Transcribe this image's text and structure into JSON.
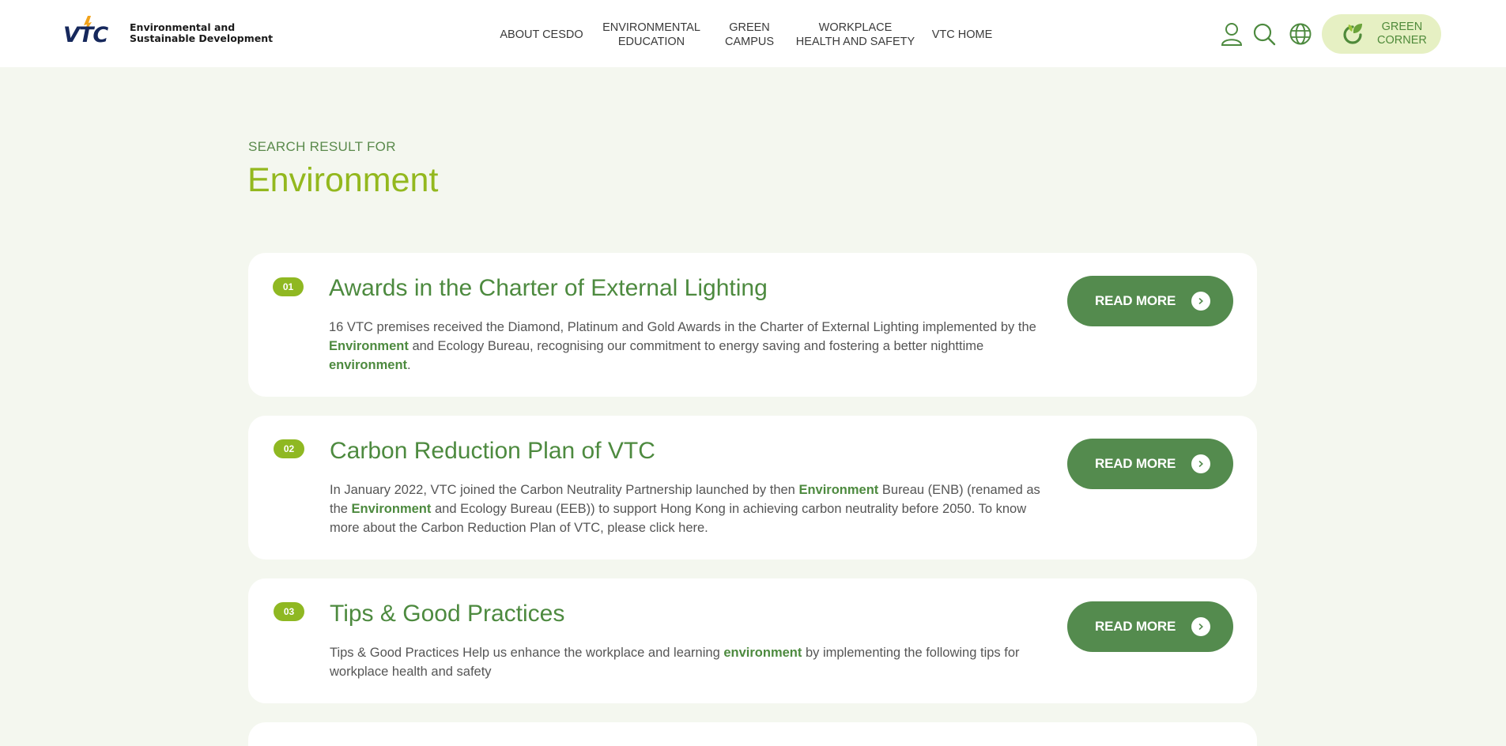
{
  "header": {
    "logo": {
      "mark": "VTC",
      "line1": "Environmental and",
      "line2": "Sustainable Development"
    },
    "nav": [
      {
        "label": "ABOUT CESDO"
      },
      {
        "label": "ENVIRONMENTAL\nEDUCATION"
      },
      {
        "label": "GREEN\nCAMPUS"
      },
      {
        "label": "WORKPLACE\nHEALTH AND SAFETY"
      },
      {
        "label": "VTC HOME"
      }
    ],
    "icons": [
      "user-icon",
      "search-icon",
      "globe-icon"
    ],
    "green_corner": {
      "label": "GREEN\nCORNER",
      "icon": "leaf-cycle-icon"
    }
  },
  "search": {
    "label": "SEARCH RESULT FOR",
    "term": "Environment"
  },
  "results": [
    {
      "number": "01",
      "title": "Awards in the Charter of External Lighting",
      "description_parts": [
        {
          "text": "16 VTC premises received the Diamond, Platinum and Gold Awards in the Charter of External Lighting implemented by the ",
          "hl": false
        },
        {
          "text": "Environment",
          "hl": true
        },
        {
          "text": " and Ecology Bureau, recognising our commitment to energy saving and fostering a better nighttime ",
          "hl": false
        },
        {
          "text": "environment",
          "hl": true
        },
        {
          "text": ".",
          "hl": false
        }
      ],
      "button": "READ MORE"
    },
    {
      "number": "02",
      "title": "Carbon Reduction Plan of VTC",
      "description_parts": [
        {
          "text": "In January 2022, VTC joined the Carbon Neutrality Partnership launched by then ",
          "hl": false
        },
        {
          "text": "Environment",
          "hl": true
        },
        {
          "text": " Bureau (ENB) (renamed as the ",
          "hl": false
        },
        {
          "text": "Environment",
          "hl": true
        },
        {
          "text": " and Ecology Bureau (EEB)) to support Hong Kong in achieving carbon neutrality before 2050. To know more about the Carbon Reduction Plan of VTC, please click here.",
          "hl": false
        }
      ],
      "button": "READ MORE"
    },
    {
      "number": "03",
      "title": "Tips & Good Practices",
      "description_parts": [
        {
          "text": "Tips & Good Practices Help us enhance the workplace and learning ",
          "hl": false
        },
        {
          "text": "environment",
          "hl": true
        },
        {
          "text": " by implementing the following tips for  workplace health and safety",
          "hl": false
        }
      ],
      "button": "READ MORE"
    }
  ],
  "colors": {
    "page_bg": "#f4f7ef",
    "accent_green": "#548b4e",
    "lime": "#93b81e",
    "title_green": "#4d8a3f",
    "green_corner_bg": "#e6f0c3"
  }
}
